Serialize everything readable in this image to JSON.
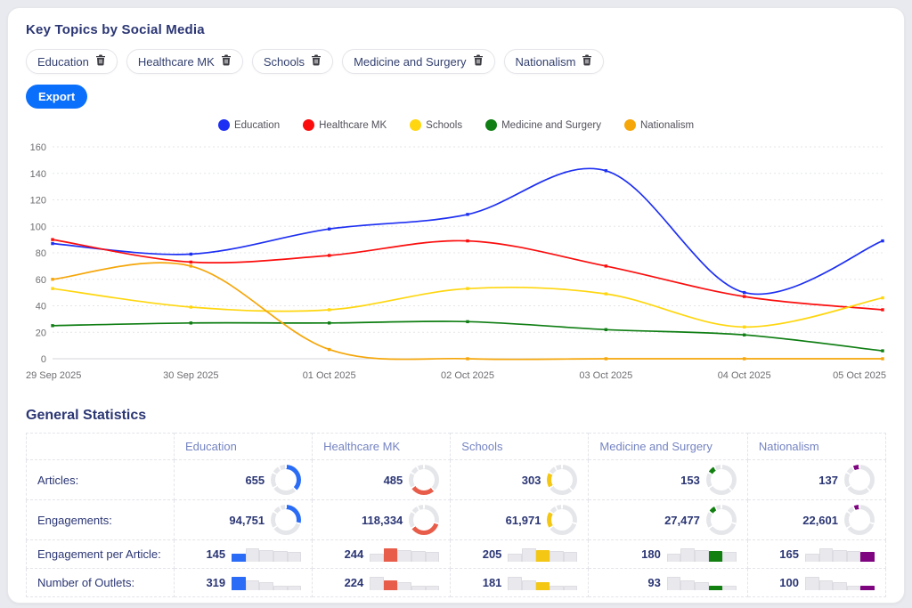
{
  "page": {
    "title": "Key Topics by Social Media"
  },
  "toolbar": {
    "export_label": "Export"
  },
  "topics": [
    {
      "label": "Education",
      "line_color": "#1d2ff2",
      "stat_color": "#2a6cf5"
    },
    {
      "label": "Healthcare MK",
      "line_color": "#fc0d0d",
      "stat_color": "#e85d4a"
    },
    {
      "label": "Schools",
      "line_color": "#ffd60f",
      "stat_color": "#f3c713"
    },
    {
      "label": "Medicine and Surgery",
      "line_color": "#0f7e13",
      "stat_color": "#118011"
    },
    {
      "label": "Nationalism",
      "line_color": "#f5a609",
      "stat_color": "#7e0480"
    }
  ],
  "chart_data": {
    "type": "line",
    "x": [
      "29 Sep 2025",
      "30 Sep 2025",
      "01 Oct 2025",
      "02 Oct 2025",
      "03 Oct 2025",
      "04 Oct 2025",
      "05 Oct 2025"
    ],
    "series": [
      {
        "name": "Education",
        "color": "#1d2ff2",
        "values": [
          87,
          79,
          98,
          109,
          142,
          50,
          89
        ]
      },
      {
        "name": "Healthcare MK",
        "color": "#fc0d0d",
        "values": [
          90,
          73,
          78,
          89,
          70,
          47,
          37
        ]
      },
      {
        "name": "Schools",
        "color": "#ffd60f",
        "values": [
          53,
          39,
          37,
          53,
          49,
          24,
          46
        ]
      },
      {
        "name": "Medicine and Surgery",
        "color": "#0f7e13",
        "values": [
          25,
          27,
          27,
          28,
          22,
          18,
          6
        ]
      },
      {
        "name": "Nationalism",
        "color": "#f5a609",
        "values": [
          60,
          70,
          7,
          0,
          0,
          0,
          0
        ]
      }
    ],
    "ylim": [
      0,
      160
    ],
    "ytick_step": 20,
    "grid": "horizontal-dashed",
    "legend_position": "top-center",
    "curve": "smooth"
  },
  "stats": {
    "heading": "General Statistics",
    "row_labels": {
      "articles": "Articles:",
      "engagements": "Engagements:",
      "epa": "Engagement per Article:",
      "outlets": "Number of Outlets:"
    },
    "columns": [
      {
        "name": "Education",
        "articles": "655",
        "engagements": "94,751",
        "epa": "145",
        "outlets": "319"
      },
      {
        "name": "Healthcare MK",
        "articles": "485",
        "engagements": "118,334",
        "epa": "244",
        "outlets": "224"
      },
      {
        "name": "Schools",
        "articles": "303",
        "engagements": "61,971",
        "epa": "205",
        "outlets": "181"
      },
      {
        "name": "Medicine and Surgery",
        "articles": "153",
        "engagements": "27,477",
        "epa": "180",
        "outlets": "93"
      },
      {
        "name": "Nationalism",
        "articles": "137",
        "engagements": "22,601",
        "epa": "165",
        "outlets": "100"
      }
    ],
    "articles_values": [
      655,
      485,
      303,
      153,
      137
    ],
    "engagements_values": [
      94751,
      118334,
      61971,
      27477,
      22601
    ],
    "epa_values": [
      145,
      244,
      205,
      180,
      165
    ],
    "outlets_values": [
      319,
      224,
      181,
      93,
      100
    ]
  }
}
